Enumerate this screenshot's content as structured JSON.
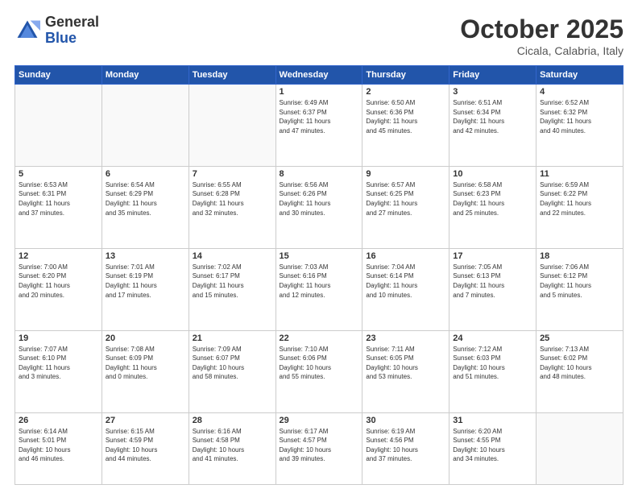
{
  "header": {
    "logo_general": "General",
    "logo_blue": "Blue",
    "month_title": "October 2025",
    "subtitle": "Cicala, Calabria, Italy"
  },
  "days_of_week": [
    "Sunday",
    "Monday",
    "Tuesday",
    "Wednesday",
    "Thursday",
    "Friday",
    "Saturday"
  ],
  "weeks": [
    [
      {
        "day": "",
        "info": ""
      },
      {
        "day": "",
        "info": ""
      },
      {
        "day": "",
        "info": ""
      },
      {
        "day": "1",
        "info": "Sunrise: 6:49 AM\nSunset: 6:37 PM\nDaylight: 11 hours\nand 47 minutes."
      },
      {
        "day": "2",
        "info": "Sunrise: 6:50 AM\nSunset: 6:36 PM\nDaylight: 11 hours\nand 45 minutes."
      },
      {
        "day": "3",
        "info": "Sunrise: 6:51 AM\nSunset: 6:34 PM\nDaylight: 11 hours\nand 42 minutes."
      },
      {
        "day": "4",
        "info": "Sunrise: 6:52 AM\nSunset: 6:32 PM\nDaylight: 11 hours\nand 40 minutes."
      }
    ],
    [
      {
        "day": "5",
        "info": "Sunrise: 6:53 AM\nSunset: 6:31 PM\nDaylight: 11 hours\nand 37 minutes."
      },
      {
        "day": "6",
        "info": "Sunrise: 6:54 AM\nSunset: 6:29 PM\nDaylight: 11 hours\nand 35 minutes."
      },
      {
        "day": "7",
        "info": "Sunrise: 6:55 AM\nSunset: 6:28 PM\nDaylight: 11 hours\nand 32 minutes."
      },
      {
        "day": "8",
        "info": "Sunrise: 6:56 AM\nSunset: 6:26 PM\nDaylight: 11 hours\nand 30 minutes."
      },
      {
        "day": "9",
        "info": "Sunrise: 6:57 AM\nSunset: 6:25 PM\nDaylight: 11 hours\nand 27 minutes."
      },
      {
        "day": "10",
        "info": "Sunrise: 6:58 AM\nSunset: 6:23 PM\nDaylight: 11 hours\nand 25 minutes."
      },
      {
        "day": "11",
        "info": "Sunrise: 6:59 AM\nSunset: 6:22 PM\nDaylight: 11 hours\nand 22 minutes."
      }
    ],
    [
      {
        "day": "12",
        "info": "Sunrise: 7:00 AM\nSunset: 6:20 PM\nDaylight: 11 hours\nand 20 minutes."
      },
      {
        "day": "13",
        "info": "Sunrise: 7:01 AM\nSunset: 6:19 PM\nDaylight: 11 hours\nand 17 minutes."
      },
      {
        "day": "14",
        "info": "Sunrise: 7:02 AM\nSunset: 6:17 PM\nDaylight: 11 hours\nand 15 minutes."
      },
      {
        "day": "15",
        "info": "Sunrise: 7:03 AM\nSunset: 6:16 PM\nDaylight: 11 hours\nand 12 minutes."
      },
      {
        "day": "16",
        "info": "Sunrise: 7:04 AM\nSunset: 6:14 PM\nDaylight: 11 hours\nand 10 minutes."
      },
      {
        "day": "17",
        "info": "Sunrise: 7:05 AM\nSunset: 6:13 PM\nDaylight: 11 hours\nand 7 minutes."
      },
      {
        "day": "18",
        "info": "Sunrise: 7:06 AM\nSunset: 6:12 PM\nDaylight: 11 hours\nand 5 minutes."
      }
    ],
    [
      {
        "day": "19",
        "info": "Sunrise: 7:07 AM\nSunset: 6:10 PM\nDaylight: 11 hours\nand 3 minutes."
      },
      {
        "day": "20",
        "info": "Sunrise: 7:08 AM\nSunset: 6:09 PM\nDaylight: 11 hours\nand 0 minutes."
      },
      {
        "day": "21",
        "info": "Sunrise: 7:09 AM\nSunset: 6:07 PM\nDaylight: 10 hours\nand 58 minutes."
      },
      {
        "day": "22",
        "info": "Sunrise: 7:10 AM\nSunset: 6:06 PM\nDaylight: 10 hours\nand 55 minutes."
      },
      {
        "day": "23",
        "info": "Sunrise: 7:11 AM\nSunset: 6:05 PM\nDaylight: 10 hours\nand 53 minutes."
      },
      {
        "day": "24",
        "info": "Sunrise: 7:12 AM\nSunset: 6:03 PM\nDaylight: 10 hours\nand 51 minutes."
      },
      {
        "day": "25",
        "info": "Sunrise: 7:13 AM\nSunset: 6:02 PM\nDaylight: 10 hours\nand 48 minutes."
      }
    ],
    [
      {
        "day": "26",
        "info": "Sunrise: 6:14 AM\nSunset: 5:01 PM\nDaylight: 10 hours\nand 46 minutes."
      },
      {
        "day": "27",
        "info": "Sunrise: 6:15 AM\nSunset: 4:59 PM\nDaylight: 10 hours\nand 44 minutes."
      },
      {
        "day": "28",
        "info": "Sunrise: 6:16 AM\nSunset: 4:58 PM\nDaylight: 10 hours\nand 41 minutes."
      },
      {
        "day": "29",
        "info": "Sunrise: 6:17 AM\nSunset: 4:57 PM\nDaylight: 10 hours\nand 39 minutes."
      },
      {
        "day": "30",
        "info": "Sunrise: 6:19 AM\nSunset: 4:56 PM\nDaylight: 10 hours\nand 37 minutes."
      },
      {
        "day": "31",
        "info": "Sunrise: 6:20 AM\nSunset: 4:55 PM\nDaylight: 10 hours\nand 34 minutes."
      },
      {
        "day": "",
        "info": ""
      }
    ]
  ]
}
